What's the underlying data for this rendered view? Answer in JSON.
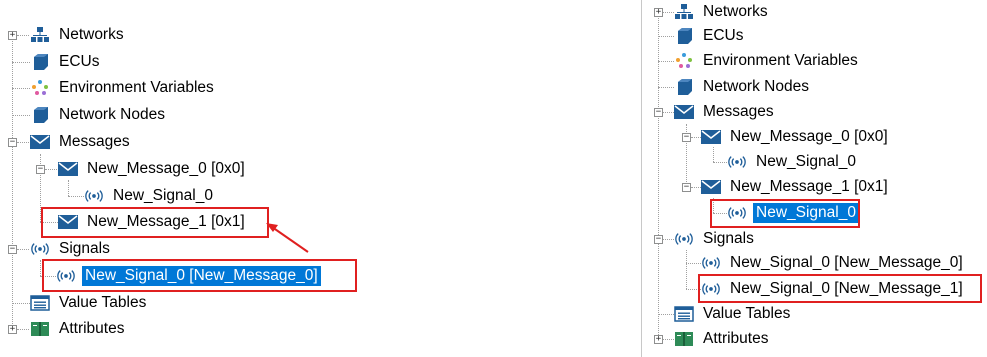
{
  "left_tree": {
    "networks": "Networks",
    "ecus": "ECUs",
    "environment_variables": "Environment Variables",
    "network_nodes": "Network Nodes",
    "messages": "Messages",
    "message_0": "New_Message_0 [0x0]",
    "message_0_signal": "New_Signal_0",
    "message_1": "New_Message_1 [0x1]",
    "signals": "Signals",
    "signal_0": "New_Signal_0 [New_Message_0]",
    "value_tables": "Value Tables",
    "attributes": "Attributes"
  },
  "right_tree": {
    "networks": "Networks",
    "ecus": "ECUs",
    "environment_variables": "Environment Variables",
    "network_nodes": "Network Nodes",
    "messages": "Messages",
    "message_0": "New_Message_0 [0x0]",
    "message_0_signal": "New_Signal_0",
    "message_1": "New_Message_1 [0x1]",
    "message_1_signal": "New_Signal_0",
    "signals": "Signals",
    "signal_0": "New_Signal_0 [New_Message_0]",
    "signal_1": "New_Signal_0 [New_Message_1]",
    "value_tables": "Value Tables",
    "attributes": "Attributes"
  },
  "colors": {
    "selection": "#0078d7",
    "highlight": "#e02020",
    "icon_blue": "#1f5e99"
  },
  "icons": [
    "network-icon",
    "ecu-icon",
    "environment-variables-icon",
    "network-node-icon",
    "message-envelope-icon",
    "signal-icon",
    "value-table-icon",
    "attributes-book-icon"
  ]
}
